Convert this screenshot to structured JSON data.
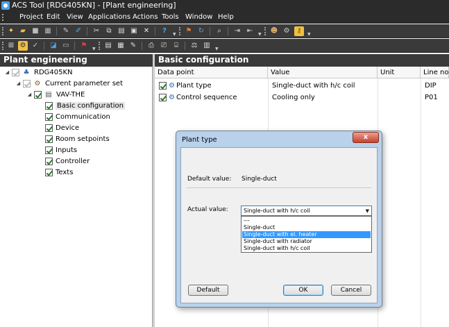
{
  "window": {
    "title": "ACS Tool [RDG405KN] - [Plant engineering]"
  },
  "menu": [
    "Project",
    "Edit",
    "View",
    "Applications",
    "Actions",
    "Tools",
    "Window",
    "Help"
  ],
  "left_panel": {
    "title": "Plant engineering",
    "tree": [
      {
        "label": "RDG405KN",
        "icon": "device-tree-icon",
        "checked": true,
        "grey": true,
        "expanded": true
      },
      {
        "label": "Current parameter set",
        "icon": "parameter-set-icon",
        "checked": true,
        "grey": true,
        "expanded": true
      },
      {
        "label": "VAV-THE",
        "icon": "document-icon",
        "checked": true,
        "grey": false,
        "expanded": true
      },
      {
        "label": "Basic configuration",
        "checked": true,
        "selected": true
      },
      {
        "label": "Communication",
        "checked": true
      },
      {
        "label": "Device",
        "checked": true
      },
      {
        "label": "Room setpoints",
        "checked": true
      },
      {
        "label": "Inputs",
        "checked": true
      },
      {
        "label": "Controller",
        "checked": true
      },
      {
        "label": "Texts",
        "checked": true
      }
    ]
  },
  "right_panel": {
    "title": "Basic configuration",
    "columns": [
      "Data point",
      "Value",
      "Unit",
      "Line no."
    ],
    "rows": [
      {
        "data_point": "Plant type",
        "value": "Single-duct with h/c coil",
        "unit": "",
        "line_no": "DIP"
      },
      {
        "data_point": "Control sequence",
        "value": "Cooling only",
        "unit": "",
        "line_no": "P01"
      }
    ]
  },
  "dialog": {
    "title": "Plant type",
    "close_label": "x",
    "default_value_label": "Default value:",
    "default_value": "Single-duct",
    "actual_value_label": "Actual value:",
    "actual_value": "Single-duct with h/c coil",
    "options": [
      "---",
      "Single-duct",
      "Single-duct with el. heater",
      "Single-duct with radiator",
      "Single-duct with h/c coil"
    ],
    "highlighted_option": 2,
    "buttons": {
      "default": "Default",
      "ok": "OK",
      "cancel": "Cancel"
    }
  },
  "colors": {
    "highlight": "#3399ff",
    "dark_chrome": "#2b2b2b",
    "dialog_frame": "#b9d1ea"
  }
}
